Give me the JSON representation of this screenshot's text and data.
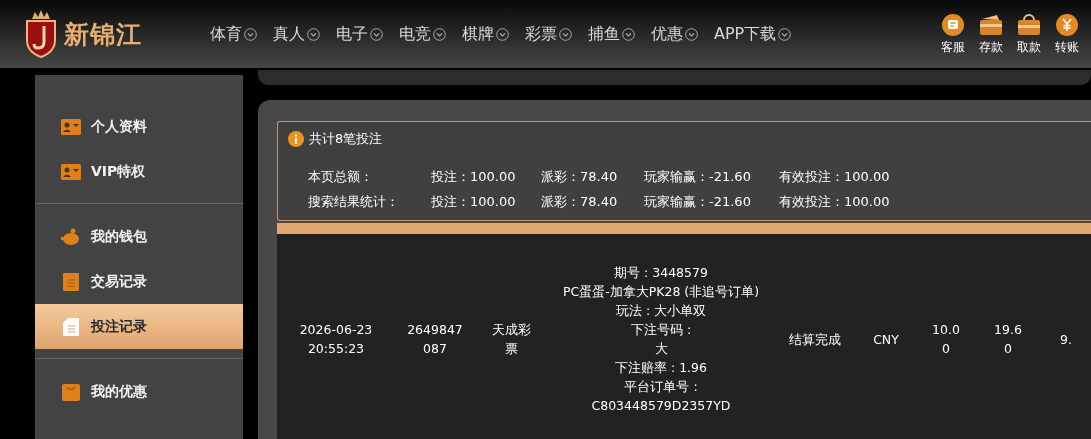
{
  "brand": {
    "name": "新锦江"
  },
  "nav": [
    {
      "label": "体育"
    },
    {
      "label": "真人"
    },
    {
      "label": "电子"
    },
    {
      "label": "电竞"
    },
    {
      "label": "棋牌"
    },
    {
      "label": "彩票"
    },
    {
      "label": "捕鱼"
    },
    {
      "label": "优惠"
    },
    {
      "label": "APP下载"
    }
  ],
  "header_actions": [
    {
      "label": "客服",
      "kind": "chat"
    },
    {
      "label": "存款",
      "kind": "wallet"
    },
    {
      "label": "取款",
      "kind": "card"
    },
    {
      "label": "转账",
      "kind": "yuan"
    }
  ],
  "sidebar": {
    "groups": [
      {
        "items": [
          {
            "label": "个人资料",
            "kind": "profile",
            "selected": false
          },
          {
            "label": "VIP特权",
            "kind": "profile",
            "selected": false
          }
        ]
      },
      {
        "items": [
          {
            "label": "我的钱包",
            "kind": "piggy",
            "selected": false
          },
          {
            "label": "交易记录",
            "kind": "list",
            "selected": false
          },
          {
            "label": "投注记录",
            "kind": "doc",
            "selected": true
          }
        ]
      },
      {
        "items": [
          {
            "label": "我的优惠",
            "kind": "bag",
            "selected": false
          }
        ]
      }
    ]
  },
  "summary": {
    "title": "共计8笔投注",
    "rows": [
      {
        "label": "本页总额：",
        "bet": "投注：100.00",
        "payout": "派彩：78.40",
        "winloss": "玩家输赢：-21.60",
        "valid": "有效投注：100.00"
      },
      {
        "label": "搜索结果统计：",
        "bet": "投注：100.00",
        "payout": "派彩：78.40",
        "winloss": "玩家输赢：-21.60",
        "valid": "有效投注：100.00"
      }
    ]
  },
  "bets": {
    "rows": [
      {
        "cells": [
          {
            "lines": [
              "2026-06-23",
              "20:55:23"
            ]
          },
          {
            "lines": [
              "2649847",
              "087"
            ]
          },
          {
            "lines": [
              "天成彩",
              "票"
            ]
          },
          {
            "lines": [
              "期号 : 3448579",
              "PC蛋蛋-加拿大PK28 (非追号订单)",
              "玩法 : 大小单双",
              "下注号码 :",
              "大",
              "下注赔率 : 1.96",
              "平台订单号 :",
              "C803448579D2357YD"
            ]
          },
          {
            "lines": [
              "结算完成"
            ]
          },
          {
            "lines": [
              "CNY"
            ]
          },
          {
            "lines": [
              "10.0",
              "0"
            ]
          },
          {
            "lines": [
              "19.6",
              "0"
            ]
          },
          {
            "lines": [
              "9."
            ]
          }
        ]
      }
    ]
  }
}
